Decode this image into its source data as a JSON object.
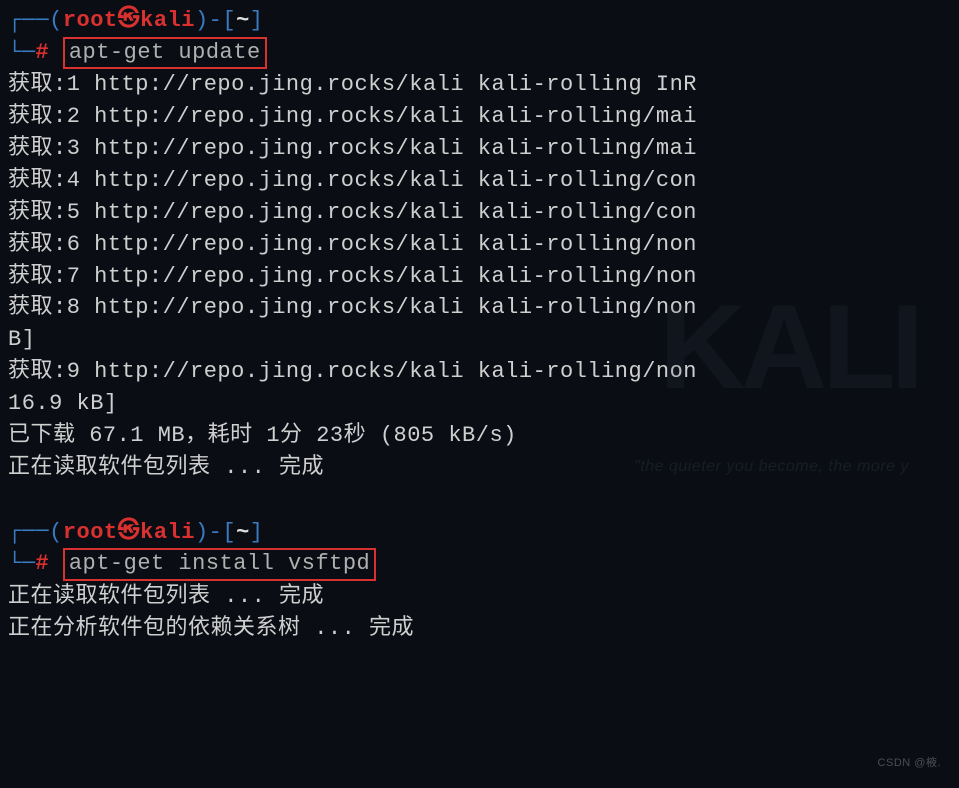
{
  "prompt": {
    "user": "root",
    "separator_icon": "㉿",
    "host": "kali",
    "path": "~",
    "open_paren": "(",
    "close_paren": ")",
    "dash_open": "-[",
    "close_bracket": "]",
    "hash": "#"
  },
  "commands": {
    "cmd1": "apt-get update",
    "cmd2": "apt-get install vsftpd"
  },
  "output": {
    "l1": "获取:1 http://repo.jing.rocks/kali kali-rolling InR",
    "l2": "获取:2 http://repo.jing.rocks/kali kali-rolling/mai",
    "l3": "获取:3 http://repo.jing.rocks/kali kali-rolling/mai",
    "l4": "获取:4 http://repo.jing.rocks/kali kali-rolling/con",
    "l5": "获取:5 http://repo.jing.rocks/kali kali-rolling/con",
    "l6": "获取:6 http://repo.jing.rocks/kali kali-rolling/non",
    "l7": "获取:7 http://repo.jing.rocks/kali kali-rolling/non",
    "l8": "获取:8 http://repo.jing.rocks/kali kali-rolling/non",
    "l9": "B]",
    "l10": "获取:9 http://repo.jing.rocks/kali kali-rolling/non",
    "l11": "16.9 kB]",
    "l12": "已下载 67.1 MB，耗时 1分 23秒 (805 kB/s)",
    "l13": "正在读取软件包列表 ... 完成",
    "l14": "正在读取软件包列表 ... 完成",
    "l15": "正在分析软件包的依赖关系树 ... 完成"
  },
  "watermark": {
    "logo": "KALI",
    "sub": "\"the quieter you become, the more y",
    "csdn": "CSDN @棭."
  }
}
